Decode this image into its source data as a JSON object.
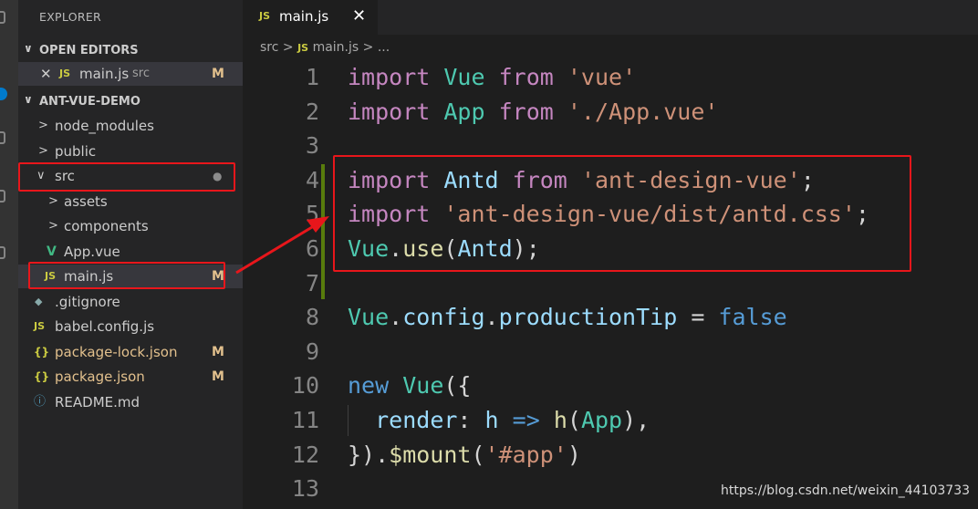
{
  "explorer": {
    "title": "EXPLORER",
    "open_editors_label": "OPEN EDITORS",
    "open_editor": {
      "name": "main.js",
      "folder": "src",
      "status": "M",
      "icon": "js-icon"
    },
    "project_label": "ANT-VUE-DEMO",
    "tree": [
      {
        "label": "node_modules",
        "type": "folder",
        "collapsed": true
      },
      {
        "label": "public",
        "type": "folder",
        "collapsed": true
      },
      {
        "label": "src",
        "type": "folder",
        "collapsed": false,
        "status_dot": "●"
      },
      {
        "label": "assets",
        "type": "folder",
        "collapsed": true
      },
      {
        "label": "components",
        "type": "folder",
        "collapsed": true
      },
      {
        "label": "App.vue",
        "type": "file",
        "icon": "vue-icon"
      },
      {
        "label": "main.js",
        "type": "file",
        "icon": "js-icon",
        "status": "M"
      },
      {
        "label": ".gitignore",
        "type": "file",
        "icon": "git-icon"
      },
      {
        "label": "babel.config.js",
        "type": "file",
        "icon": "js-icon"
      },
      {
        "label": "package-lock.json",
        "type": "file",
        "icon": "json-icon",
        "status": "M"
      },
      {
        "label": "package.json",
        "type": "file",
        "icon": "json-icon",
        "status": "M"
      },
      {
        "label": "README.md",
        "type": "file",
        "icon": "info-icon"
      }
    ]
  },
  "tab": {
    "icon_text": "JS",
    "label": "main.js",
    "close": "✕"
  },
  "breadcrumb": {
    "folder": "src",
    "sep": ">",
    "icon_text": "JS",
    "file": "main.js",
    "more": "..."
  },
  "icons": {
    "js": "JS",
    "json": "{}",
    "vue": "V",
    "git": "◆",
    "info": "ⓘ",
    "close": "✕",
    "chev_down": "∨",
    "chev_right": ">"
  },
  "code_lines": [
    {
      "n": "1",
      "tokens": [
        [
          "kw",
          "import"
        ],
        [
          "",
          " "
        ],
        [
          "cls",
          "Vue"
        ],
        [
          "",
          " "
        ],
        [
          "kw",
          "from"
        ],
        [
          "",
          " "
        ],
        [
          "str",
          "'vue'"
        ]
      ]
    },
    {
      "n": "2",
      "tokens": [
        [
          "kw",
          "import"
        ],
        [
          "",
          " "
        ],
        [
          "cls",
          "App"
        ],
        [
          "",
          " "
        ],
        [
          "kw",
          "from"
        ],
        [
          "",
          " "
        ],
        [
          "str",
          "'./App.vue'"
        ]
      ]
    },
    {
      "n": "3",
      "tokens": []
    },
    {
      "n": "4",
      "tokens": [
        [
          "kw",
          "import"
        ],
        [
          "",
          " "
        ],
        [
          "var",
          "Antd"
        ],
        [
          "",
          " "
        ],
        [
          "kw",
          "from"
        ],
        [
          "",
          " "
        ],
        [
          "str",
          "'ant-design-vue'"
        ],
        [
          "",
          ";"
        ]
      ]
    },
    {
      "n": "5",
      "tokens": [
        [
          "kw",
          "import"
        ],
        [
          "",
          " "
        ],
        [
          "str",
          "'ant-design-vue/dist/antd.css'"
        ],
        [
          "",
          ";"
        ]
      ]
    },
    {
      "n": "6",
      "tokens": [
        [
          "cls",
          "Vue"
        ],
        [
          "",
          "."
        ],
        [
          "fn",
          "use"
        ],
        [
          "",
          "("
        ],
        [
          "var",
          "Antd"
        ],
        [
          "",
          ");"
        ]
      ]
    },
    {
      "n": "7",
      "tokens": []
    },
    {
      "n": "8",
      "tokens": [
        [
          "cls",
          "Vue"
        ],
        [
          "",
          "."
        ],
        [
          "var",
          "config"
        ],
        [
          "",
          "."
        ],
        [
          "var",
          "productionTip"
        ],
        [
          "",
          " = "
        ],
        [
          "bool",
          "false"
        ]
      ]
    },
    {
      "n": "9",
      "tokens": []
    },
    {
      "n": "10",
      "tokens": [
        [
          "blue",
          "new"
        ],
        [
          "",
          " "
        ],
        [
          "cls",
          "Vue"
        ],
        [
          "",
          "({"
        ]
      ]
    },
    {
      "n": "11",
      "tokens": [
        [
          "",
          "  "
        ],
        [
          "var",
          "render"
        ],
        [
          "",
          ": "
        ],
        [
          "var",
          "h"
        ],
        [
          "",
          " "
        ],
        [
          "blue",
          "=>"
        ],
        [
          "",
          " "
        ],
        [
          "fn",
          "h"
        ],
        [
          "",
          "("
        ],
        [
          "cls",
          "App"
        ],
        [
          "",
          "),"
        ]
      ]
    },
    {
      "n": "12",
      "tokens": [
        [
          "",
          "})."
        ],
        [
          "fn",
          "$mount"
        ],
        [
          "",
          "("
        ],
        [
          "str",
          "'#app'"
        ],
        [
          "",
          ")"
        ]
      ]
    },
    {
      "n": "13",
      "tokens": []
    }
  ],
  "watermark": "https://blog.csdn.net/weixin_44103733",
  "colors": {
    "annotation_red": "#e8161b",
    "git_modified": "#e2c08d",
    "git_added_bar": "#587c0c"
  }
}
